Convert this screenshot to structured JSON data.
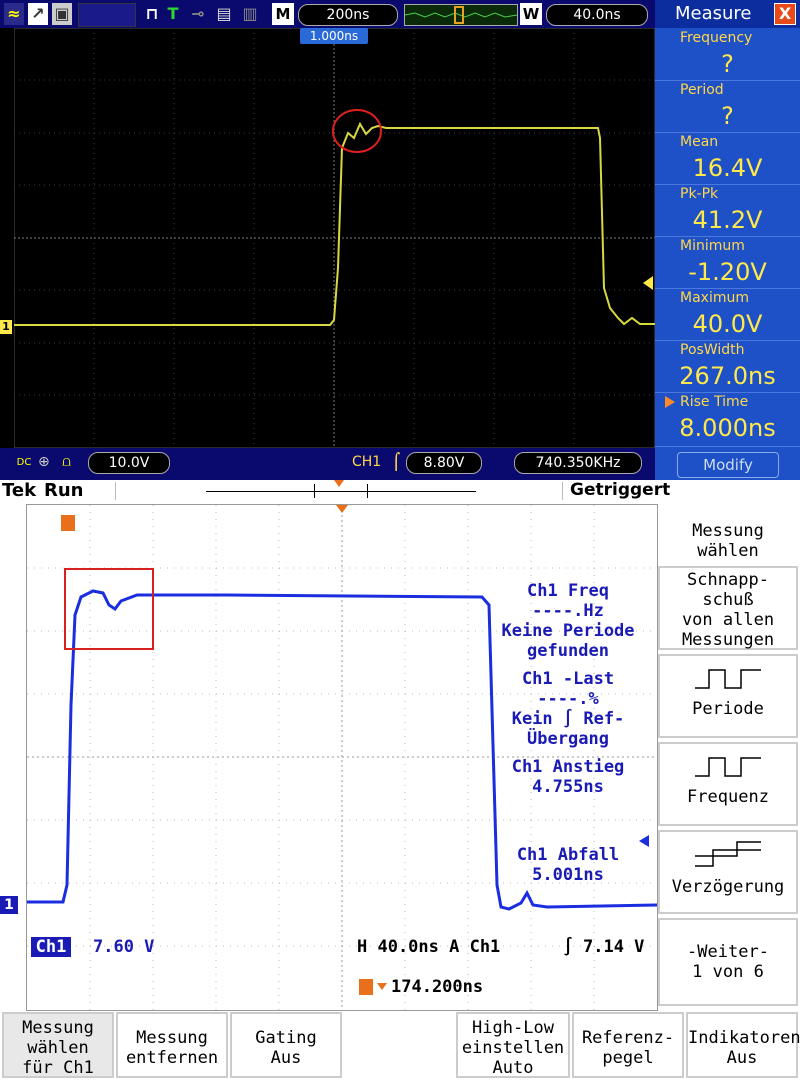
{
  "top": {
    "toolbar": {
      "run_mode_icon": "T",
      "m_label": "M",
      "timebase": "200ns",
      "w_label": "W",
      "window": "40.0ns",
      "trigger_pos": "1.000ns"
    },
    "bottom_bar": {
      "coupling": "DC",
      "ch_scale": "10.0V",
      "trig_src": "CH1",
      "trig_level": "8.80V",
      "freq": "740.350KHz"
    },
    "marker": "1",
    "measure": {
      "title": "Measure",
      "close": "X",
      "items": [
        {
          "label": "Frequency",
          "value": "?"
        },
        {
          "label": "Period",
          "value": "?"
        },
        {
          "label": "Mean",
          "value": "16.4V"
        },
        {
          "label": "Pk-Pk",
          "value": "41.2V"
        },
        {
          "label": "Minimum",
          "value": "-1.20V"
        },
        {
          "label": "Maximum",
          "value": "40.0V"
        },
        {
          "label": "PosWidth",
          "value": "267.0ns"
        },
        {
          "label": "Rise Time",
          "value": "8.000ns"
        }
      ],
      "modify": "Modify"
    },
    "colors": {
      "trace": "#d8d840",
      "accent": "#ffe84a"
    }
  },
  "bottom": {
    "brand": "Tek",
    "state": "Run",
    "triggered": "Getriggert",
    "marker": "1",
    "measurements": {
      "freq_title": "Ch1 Freq",
      "freq_value": "----.Hz",
      "freq_note1": "Keine Periode",
      "freq_note2": "gefunden",
      "duty_title": "Ch1 -Last",
      "duty_value": "----.%",
      "duty_note1": "Kein ∫ Ref-",
      "duty_note2": "Übergang",
      "rise_title": "Ch1 Anstieg",
      "rise_value": "4.755ns",
      "fall_title": "Ch1 Abfall",
      "fall_value": "5.001ns"
    },
    "status": {
      "ch": "Ch1",
      "ch_scale": "7.60 V",
      "horiz": "H 40.0ns  A  Ch1",
      "trig_level": "7.14 V",
      "trig_delay": "174.200ns"
    },
    "side_menu": {
      "select": [
        "Messung",
        "wählen"
      ],
      "snapshot": [
        "Schnapp-",
        "schuß",
        "von allen",
        "Messungen"
      ],
      "period": "Periode",
      "frequency": "Frequenz",
      "delay": "Verzögerung",
      "more": [
        "-Weiter-",
        "1 von 6"
      ]
    },
    "bottom_menu": {
      "b1": [
        "Messung",
        "wählen",
        "für Ch1"
      ],
      "b2": [
        "Messung",
        "entfernen"
      ],
      "b3": [
        "Gating",
        "Aus"
      ],
      "b4": [
        "High-Low",
        "einstellen",
        "Auto"
      ],
      "b5": [
        "Referenz-",
        "pegel"
      ],
      "b6": [
        "Indikatoren",
        "Aus"
      ]
    },
    "colors": {
      "trace": "#1a2ee0",
      "accent": "#1a1ab4"
    }
  }
}
